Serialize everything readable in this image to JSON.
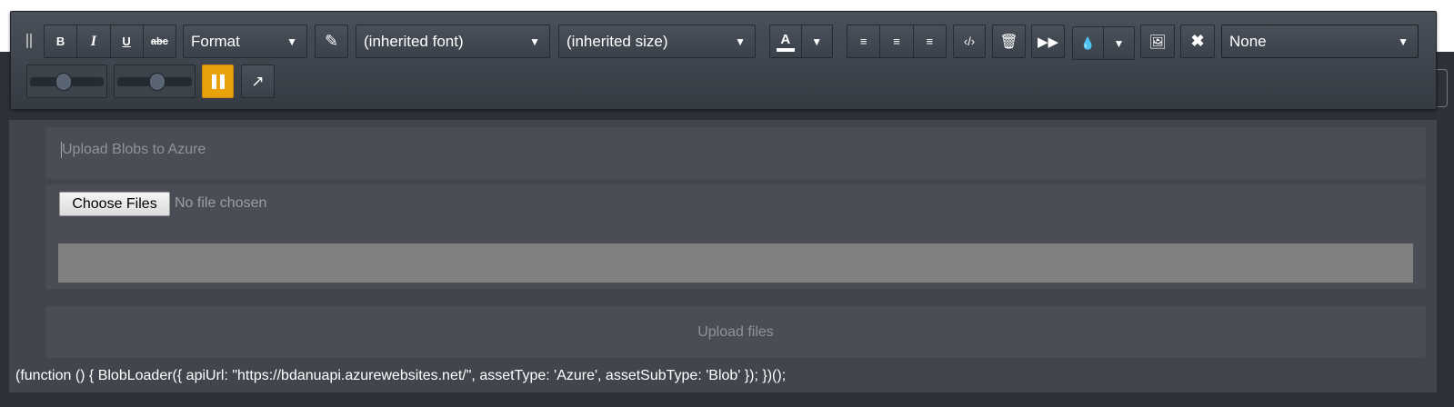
{
  "toolbar": {
    "bold": "B",
    "italic": "I",
    "underline": "U",
    "strike": "abc",
    "format": "Format",
    "font": "(inherited font)",
    "size": "(inherited size)",
    "font_color_letter": "A",
    "style": "None",
    "accent": "#e8a20c",
    "sliders": [
      0.45,
      0.5
    ]
  },
  "content": {
    "title_placeholder": "Upload Blobs to Azure",
    "choose_files": "Choose Files",
    "no_file": "No file chosen",
    "upload_button": "Upload files",
    "code": "(function () { BlobLoader({ apiUrl: \"https://bdanuapi.azurewebsites.net/\", assetType: 'Azure', assetSubType: 'Blob' }); })();"
  }
}
